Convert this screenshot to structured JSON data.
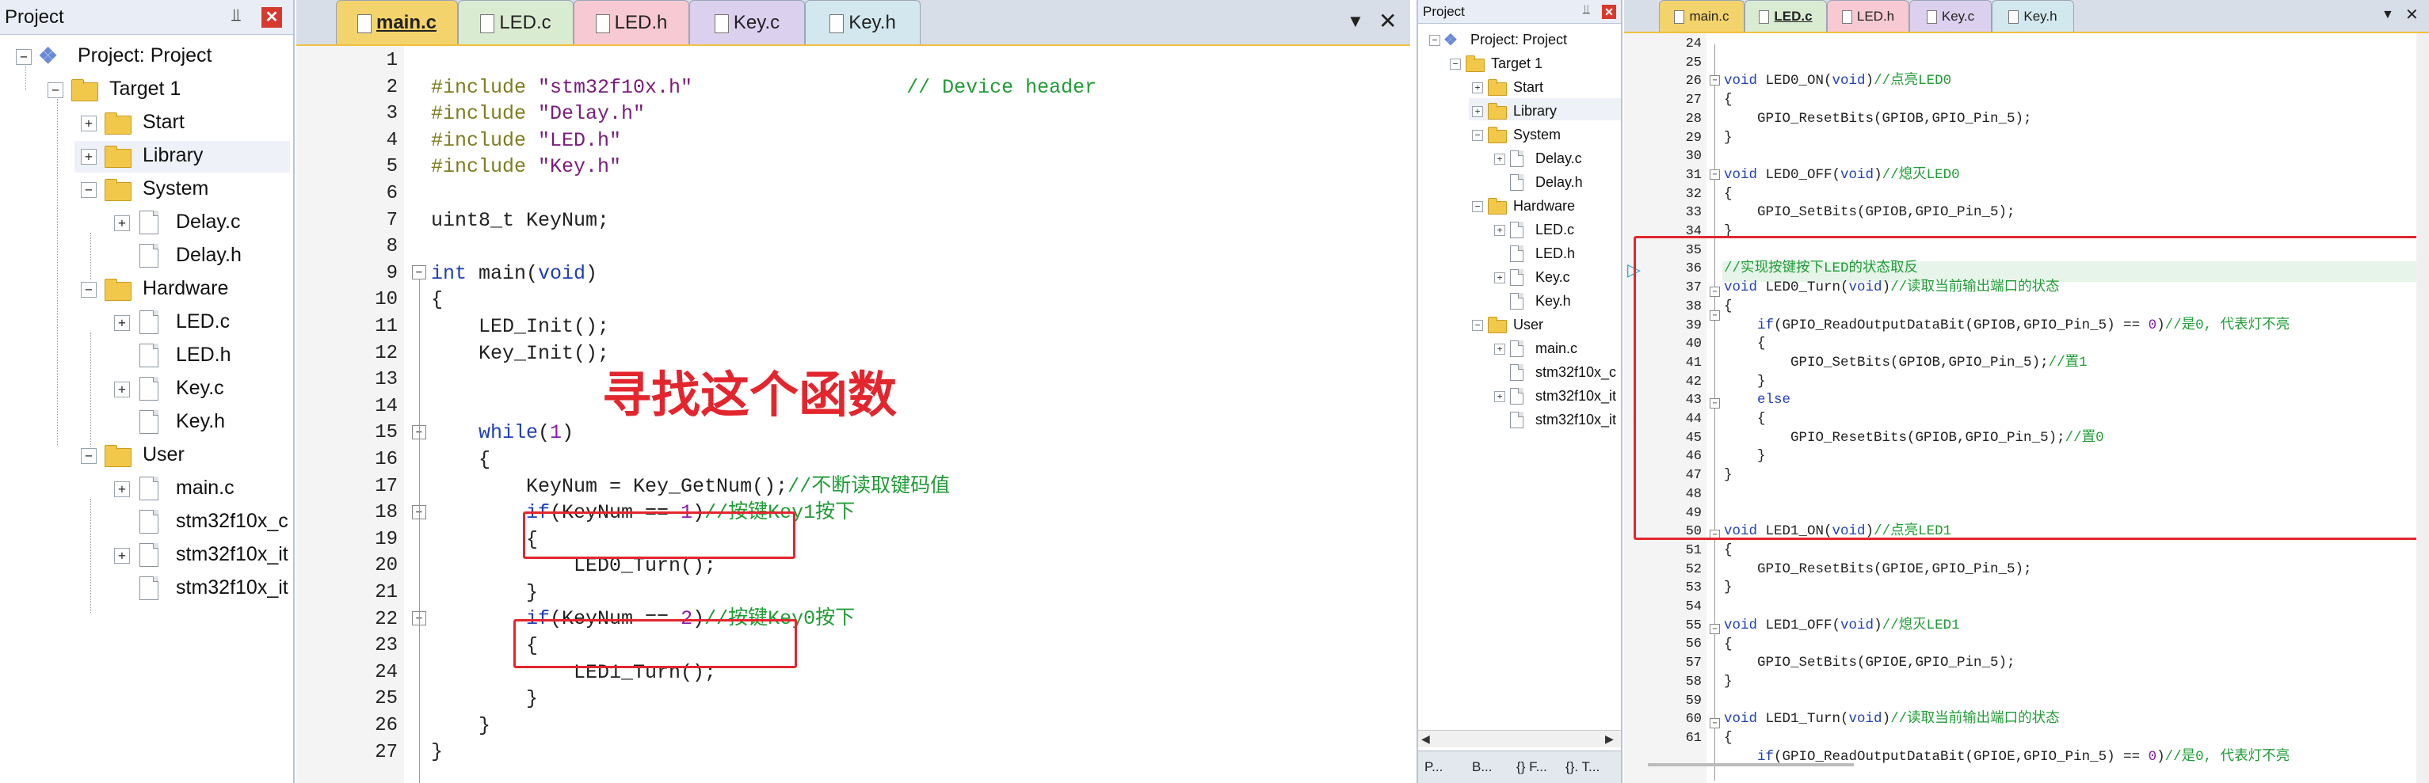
{
  "left": {
    "project": {
      "title": "Project",
      "pin_icon": "pin-icon",
      "close_label": "x",
      "root": "Project: Project",
      "target": "Target 1",
      "items": [
        "Start",
        "Library",
        "System",
        "Delay.c",
        "Delay.h",
        "Hardware",
        "LED.c",
        "LED.h",
        "Key.c",
        "Key.h",
        "User",
        "main.c",
        "stm32f10x_c",
        "stm32f10x_it",
        "stm32f10x_it"
      ]
    },
    "tabs": [
      "main.c",
      "LED.c",
      "LED.h",
      "Key.c",
      "Key.h"
    ],
    "tab_colors": [
      "#f3d36b",
      "#d9ecd2",
      "#f7c9d2",
      "#dcd0ef",
      "#d3e8ee"
    ],
    "line_numbers": [
      "1",
      "2",
      "3",
      "4",
      "5",
      "6",
      "7",
      "8",
      "9",
      "10",
      "11",
      "12",
      "13",
      "14",
      "15",
      "16",
      "17",
      "18",
      "19",
      "20",
      "21",
      "22",
      "23",
      "24",
      "25",
      "26",
      "27"
    ],
    "code": {
      "l1a": "#include ",
      "l1b": "\"stm32f10x.h\"",
      "l1c": "                  // Device header",
      "l2a": "#include ",
      "l2b": "\"Delay.h\"",
      "l3a": "#include ",
      "l3b": "\"LED.h\"",
      "l4a": "#include ",
      "l4b": "\"Key.h\"",
      "l6": "uint8_t KeyNum;",
      "l8a": "int",
      "l8b": " main(",
      "l8c": "void",
      "l8d": ")",
      "l9": "{",
      "l10": "    LED_Init();",
      "l11": "    Key_Init();",
      "l14a": "    while",
      "l14b": "(",
      "l14c": "1",
      "l14d": ")",
      "l15": "    {",
      "l16a": "        KeyNum = Key_GetNum();",
      "l16b": "//不断读取键码值",
      "l17a": "        if",
      "l17b": "(KeyNum == ",
      "l17c": "1",
      "l17d": ")",
      "l17e": "//按键Key1按下",
      "l18": "        {",
      "l19": "            LED0_Turn();",
      "l20": "        }",
      "l21a": "        if",
      "l21b": "(KeyNum == ",
      "l21c": "2",
      "l21d": ")",
      "l21e": "//按键Key0按下",
      "l22": "        {",
      "l23": "            LED1_Turn();",
      "l24": "        }",
      "l25": "    }",
      "l26": "}"
    },
    "annotation": "寻找这个函数"
  },
  "right": {
    "project": {
      "title": "Project",
      "root": "Project: Project",
      "target": "Target 1",
      "items": [
        "Start",
        "Library",
        "System",
        "Delay.c",
        "Delay.h",
        "Hardware",
        "LED.c",
        "LED.h",
        "Key.c",
        "Key.h",
        "User",
        "main.c",
        "stm32f10x_c",
        "stm32f10x_it",
        "stm32f10x_it"
      ]
    },
    "bottom_tabs": [
      "P...",
      "B...",
      "{} F...",
      "{}. T..."
    ],
    "tabs": [
      "main.c",
      "LED.c",
      "LED.h",
      "Key.c",
      "Key.h"
    ],
    "line_numbers": [
      "24",
      "25",
      "26",
      "27",
      "28",
      "29",
      "30",
      "31",
      "32",
      "33",
      "34",
      "35",
      "36",
      "37",
      "38",
      "39",
      "40",
      "41",
      "42",
      "43",
      "44",
      "45",
      "46",
      "47",
      "48",
      "49",
      "50",
      "51",
      "52",
      "53",
      "54",
      "55",
      "56",
      "57",
      "58",
      "59",
      "60",
      "61"
    ],
    "code": {
      "r25a": "void",
      "r25b": " LED0_ON(",
      "r25c": "void",
      "r25d": ")",
      "r25e": "//点亮LED0",
      "r26": "{",
      "r27": "    GPIO_ResetBits(GPIOB,GPIO_Pin_5);",
      "r28": "}",
      "r30a": "void",
      "r30b": " LED0_OFF(",
      "r30c": "void",
      "r30d": ")",
      "r30e": "//熄灭LED0",
      "r31": "{",
      "r32": "    GPIO_SetBits(GPIOB,GPIO_Pin_5);",
      "r33": "}",
      "r35": "//实现按键按下LED的状态取反",
      "r36a": "void",
      "r36b": " LED0_Turn(",
      "r36c": "void",
      "r36d": ")",
      "r36e": "//读取当前输出端口的状态",
      "r37": "{",
      "r38a": "    if",
      "r38b": "(GPIO_ReadOutputDataBit(GPIOB,GPIO_Pin_5) == ",
      "r38c": "0",
      "r38d": ")",
      "r38e": "//是0, 代表灯不亮",
      "r39": "    {",
      "r40a": "        GPIO_SetBits(GPIOB,GPIO_Pin_5);",
      "r40b": "//置1",
      "r41": "    }",
      "r42": "    else",
      "r43": "    {",
      "r44a": "        GPIO_ResetBits(GPIOB,GPIO_Pin_5);",
      "r44b": "//置0",
      "r45": "    }",
      "r46": "}",
      "r49a": "void",
      "r49b": " LED1_ON(",
      "r49c": "void",
      "r49d": ")",
      "r49e": "//点亮LED1",
      "r50": "{",
      "r51": "    GPIO_ResetBits(GPIOE,GPIO_Pin_5);",
      "r52": "}",
      "r54a": "void",
      "r54b": " LED1_OFF(",
      "r54c": "void",
      "r54d": ")",
      "r54e": "//熄灭LED1",
      "r55": "{",
      "r56": "    GPIO_SetBits(GPIOE,GPIO_Pin_5);",
      "r57": "}",
      "r59a": "void",
      "r59b": " LED1_Turn(",
      "r59c": "void",
      "r59d": ")",
      "r59e": "//读取当前输出端口的状态",
      "r60": "{",
      "r61a": "    if",
      "r61b": "(GPIO_ReadOutputDataBit(GPIOE,GPIO_Pin_5) == ",
      "r61c": "0",
      "r61d": ")",
      "r61e": "//是0, 代表灯不亮"
    }
  },
  "colors": {
    "annotation_red": "#e3262e",
    "accent_tab": "#f3d36b"
  }
}
